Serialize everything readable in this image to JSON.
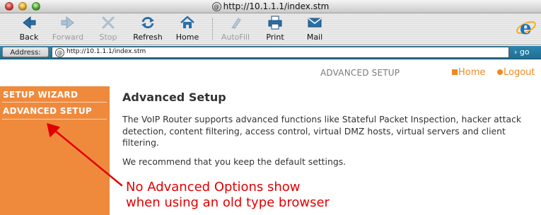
{
  "window": {
    "title": "http://10.1.1.1/index.stm"
  },
  "toolbar": {
    "back": "Back",
    "forward": "Forward",
    "stop": "Stop",
    "refresh": "Refresh",
    "home": "Home",
    "autofill": "AutoFill",
    "print": "Print",
    "mail": "Mail"
  },
  "address": {
    "label": "Address:",
    "url": "http://10.1.1.1/index.stm",
    "go": "go"
  },
  "header": {
    "section_title": "ADVANCED SETUP",
    "home_link": "Home",
    "logout_link": "Logout"
  },
  "sidebar": {
    "items": [
      {
        "label": "SETUP WIZARD"
      },
      {
        "label": "ADVANCED SETUP"
      }
    ]
  },
  "main": {
    "title": "Advanced Setup",
    "paragraphs": [
      "The VoIP Router supports advanced functions like Stateful Packet Inspection, hacker attack detection, content filtering, access control, virtual DMZ hosts, virtual servers and client filtering.",
      "We recommend that you keep the default settings."
    ]
  },
  "annotation": {
    "line1": "No Advanced Options show",
    "line2": "when using an old type browser"
  },
  "colors": {
    "accent": "#ef8a3d",
    "link": "#f08a20",
    "annotation": "#e10000",
    "address_bar": "#2479a0"
  },
  "icons": [
    "back-icon",
    "forward-icon",
    "stop-icon",
    "refresh-icon",
    "home-icon",
    "autofill-icon",
    "print-icon",
    "mail-icon",
    "ie-logo-icon",
    "globe-icon"
  ]
}
